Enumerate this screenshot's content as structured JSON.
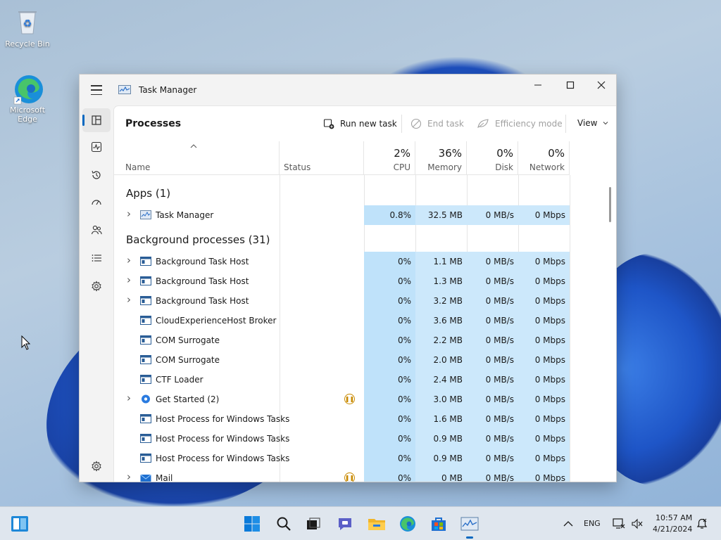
{
  "desktop": {
    "icons": [
      {
        "label": "Recycle Bin"
      },
      {
        "label": "Microsoft Edge"
      }
    ]
  },
  "window": {
    "title": "Task Manager",
    "controls": {
      "minimize": "—",
      "maximize": "☐",
      "close": "✕"
    }
  },
  "commandbar": {
    "page_title": "Processes",
    "run_new_task": "Run new task",
    "end_task": "End task",
    "efficiency_mode": "Efficiency mode",
    "view": "View"
  },
  "columns": {
    "name": "Name",
    "status": "Status",
    "cpu": {
      "pct": "2%",
      "label": "CPU"
    },
    "memory": {
      "pct": "36%",
      "label": "Memory"
    },
    "disk": {
      "pct": "0%",
      "label": "Disk"
    },
    "network": {
      "pct": "0%",
      "label": "Network"
    }
  },
  "groups": {
    "apps": "Apps (1)",
    "background": "Background processes (31)"
  },
  "apps": [
    {
      "name": "Task Manager",
      "cpu": "0.8%",
      "memory": "32.5 MB",
      "disk": "0 MB/s",
      "network": "0 Mbps",
      "expandable": true
    }
  ],
  "background": [
    {
      "name": "Background Task Host",
      "cpu": "0%",
      "memory": "1.1 MB",
      "disk": "0 MB/s",
      "network": "0 Mbps",
      "expandable": true,
      "suspended": false
    },
    {
      "name": "Background Task Host",
      "cpu": "0%",
      "memory": "1.3 MB",
      "disk": "0 MB/s",
      "network": "0 Mbps",
      "expandable": true,
      "suspended": false
    },
    {
      "name": "Background Task Host",
      "cpu": "0%",
      "memory": "3.2 MB",
      "disk": "0 MB/s",
      "network": "0 Mbps",
      "expandable": true,
      "suspended": false
    },
    {
      "name": "CloudExperienceHost Broker",
      "cpu": "0%",
      "memory": "3.6 MB",
      "disk": "0 MB/s",
      "network": "0 Mbps",
      "expandable": false,
      "suspended": false
    },
    {
      "name": "COM Surrogate",
      "cpu": "0%",
      "memory": "2.2 MB",
      "disk": "0 MB/s",
      "network": "0 Mbps",
      "expandable": false,
      "suspended": false
    },
    {
      "name": "COM Surrogate",
      "cpu": "0%",
      "memory": "2.0 MB",
      "disk": "0 MB/s",
      "network": "0 Mbps",
      "expandable": false,
      "suspended": false
    },
    {
      "name": "CTF Loader",
      "cpu": "0%",
      "memory": "2.4 MB",
      "disk": "0 MB/s",
      "network": "0 Mbps",
      "expandable": false,
      "suspended": false
    },
    {
      "name": "Get Started (2)",
      "cpu": "0%",
      "memory": "3.0 MB",
      "disk": "0 MB/s",
      "network": "0 Mbps",
      "expandable": true,
      "suspended": true
    },
    {
      "name": "Host Process for Windows Tasks",
      "cpu": "0%",
      "memory": "1.6 MB",
      "disk": "0 MB/s",
      "network": "0 Mbps",
      "expandable": false,
      "suspended": false
    },
    {
      "name": "Host Process for Windows Tasks",
      "cpu": "0%",
      "memory": "0.9 MB",
      "disk": "0 MB/s",
      "network": "0 Mbps",
      "expandable": false,
      "suspended": false
    },
    {
      "name": "Host Process for Windows Tasks",
      "cpu": "0%",
      "memory": "0.9 MB",
      "disk": "0 MB/s",
      "network": "0 Mbps",
      "expandable": false,
      "suspended": false
    },
    {
      "name": "Mail",
      "cpu": "0%",
      "memory": "0 MB",
      "disk": "0 MB/s",
      "network": "0 Mbps",
      "expandable": true,
      "suspended": true
    }
  ],
  "taskbar": {
    "language": "ENG",
    "time": "10:57 AM",
    "date": "4/21/2024"
  },
  "colors": {
    "accent": "#0067c0",
    "row_highlight": "#cce8fb",
    "suspended": "#c88a00"
  }
}
